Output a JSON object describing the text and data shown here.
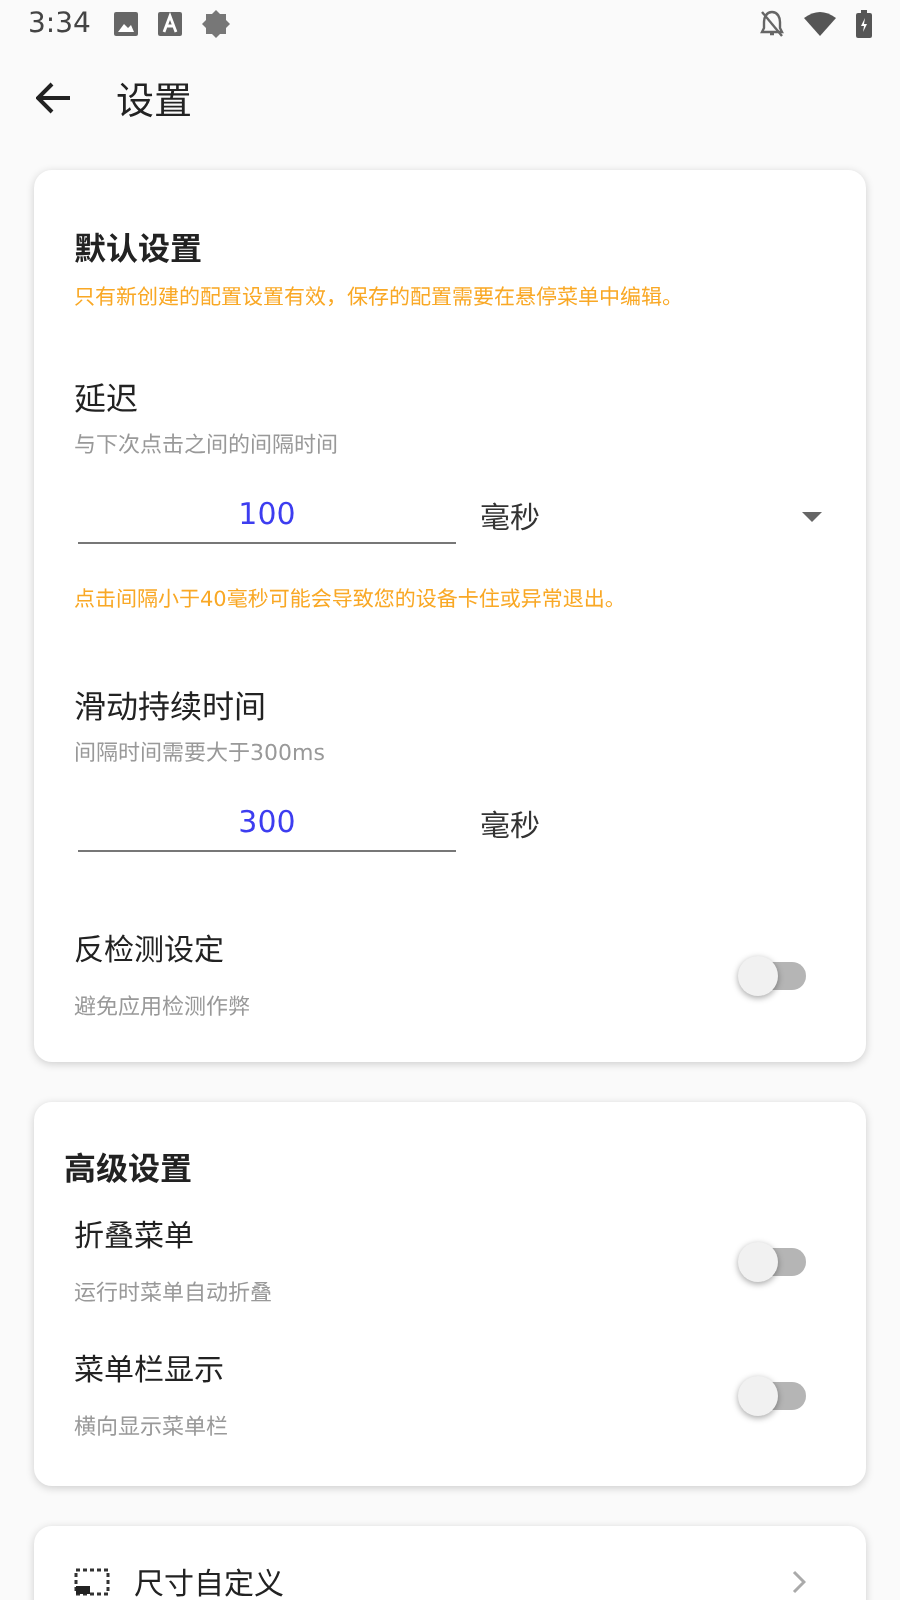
{
  "status_bar": {
    "time": "3:34"
  },
  "toolbar": {
    "title": "设置"
  },
  "default_settings": {
    "title": "默认设置",
    "note": "只有新创建的配置设置有效，保存的配置需要在悬停菜单中编辑。",
    "delay": {
      "label": "延迟",
      "hint": "与下次点击之间的间隔时间",
      "value": "100",
      "unit": "毫秒",
      "warning": "点击间隔小于40毫秒可能会导致您的设备卡住或异常退出。"
    },
    "swipe": {
      "label": "滑动持续时间",
      "hint": "间隔时间需要大于300ms",
      "value": "300",
      "unit": "毫秒"
    },
    "toggle": {
      "label": "反检测设定",
      "hint": "避免应用检测作弊",
      "on": false
    }
  },
  "advanced": {
    "title": "高级设置",
    "toggles": [
      {
        "label": "折叠菜单",
        "hint": "运行时菜单自动折叠",
        "on": false
      },
      {
        "label": "菜单栏显示",
        "hint": "横向显示菜单栏",
        "on": false
      }
    ]
  },
  "links": [
    {
      "label": "尺寸自定义"
    }
  ]
}
